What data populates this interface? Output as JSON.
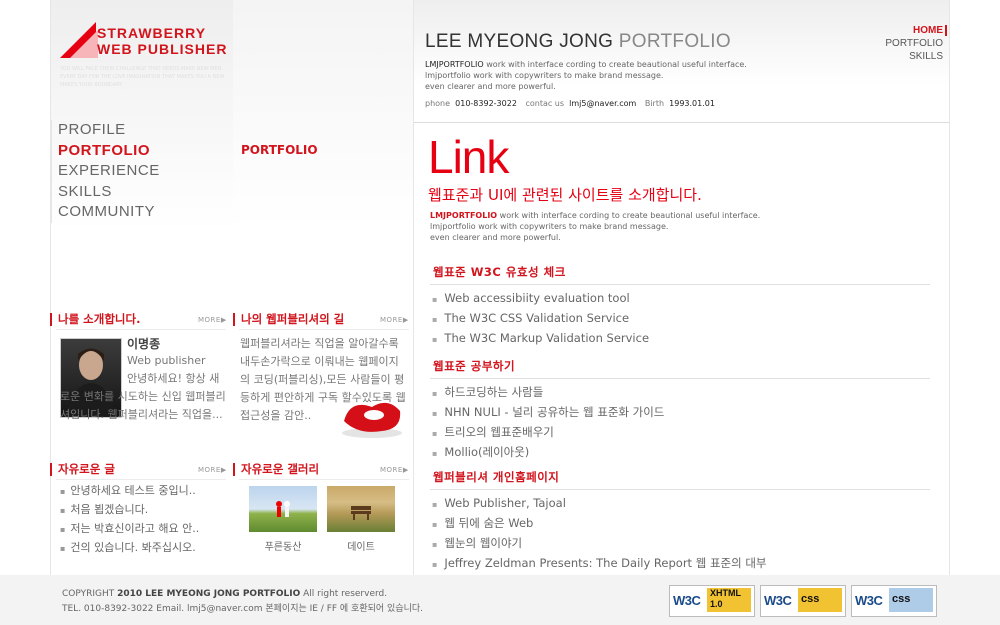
{
  "logo": {
    "line1": "STRAWBERRY",
    "line2": "WEB PUBLISHER",
    "tagline": "YOU WILL FACE THEIR CHALLENGE THAT NEEDS MAKE NEW MEN EVERY DAY FOR THE LOVE IMAGINATION THAT MAKES YOU A NEW MAKES YOUR BOUNDARY"
  },
  "nav": {
    "items": [
      "PROFILE",
      "PORTFOLIO",
      "EXPERIENCE",
      "SKILLS",
      "COMMUNITY"
    ]
  },
  "mid_title": "PORTFOLIO",
  "header": {
    "title_main": "LEE MYEONG JONG ",
    "title_accent": "PORTFOLIO",
    "desc_brand": "LMJPORTFOLIO",
    "desc1": " work with interface cording to create beautional useful interface.",
    "desc2": "lmjportfolio work with copywriters to make brand message.",
    "desc3": "even clearer and more powerful.",
    "phone_label": "phone",
    "phone": "010-8392-3022",
    "contact_label": "contac us",
    "email": "lmj5@naver.com",
    "birth_label": "Birth",
    "birth": "1993.01.01"
  },
  "top_menu": {
    "home": "HOME",
    "portfolio": "PORTFOLIO",
    "skills": "SKILLS"
  },
  "intro": {
    "heading": "나를 소개합니다.",
    "more": "MORE▶",
    "name": "이명종",
    "role": "Web publisher",
    "text": "안녕하세요! 항상 새로운 변화를 시도하는 신입 웹퍼블리셔입니다. 웹퍼블리셔라는 직업을..."
  },
  "road": {
    "heading": "나의 웹퍼블리셔의 길",
    "more": "MORE▶",
    "text": "웹퍼블리셔라는 직업을 알아갈수록 내두손가락으로 이뤄내는 웹페이지의 코딩(퍼블리싱),모든 사람들이 평등하게 편안하게 구독 할수있도록 웹접근성을 감안.."
  },
  "board": {
    "heading": "자유로운 글",
    "more": "MORE▶",
    "items": [
      "안녕하세요 테스트 중입니..",
      "처음 뵙겠습니다.",
      "저는 박효신이라고 해요 안..",
      "건의 있습니다. 봐주십시오."
    ]
  },
  "gallery": {
    "heading": "자유로운 갤러리",
    "more": "MORE▶",
    "captions": [
      "푸른동산",
      "데이트"
    ]
  },
  "main": {
    "title": "Link",
    "subtitle": "웹표준과 UI에 관련된 사이트를 소개합니다.",
    "desc_brand": "LMJPORTFOLIO",
    "desc1": " work with interface cording to create beautional useful interface.",
    "desc2": "lmjportfolio work with copywriters to make brand message.",
    "desc3": "even clearer and more powerful.",
    "categories": [
      {
        "title": "웹표준 W3C 유효성 체크",
        "links": [
          "Web accessibiity evaluation tool",
          "The W3C CSS Validation Service",
          "The W3C Markup Validation Service"
        ]
      },
      {
        "title": "웹표준 공부하기",
        "links": [
          "하드코딩하는 사람들",
          "NHN NULI - 널리 공유하는 웹 표준화 가이드",
          "트리오의 웹표준배우기",
          "Mollio(레이아웃)"
        ]
      },
      {
        "title": "웹퍼블리셔 개인홈페이지",
        "links": [
          "Web Publisher, Tajoal",
          "웹 뒤에 숨은 Web",
          "웹눈의 웹이야기",
          "Jeffrey Zeldman Presents: The Daily Report 웹 표준의 대부"
        ]
      }
    ]
  },
  "footer": {
    "copyright_pre": "COPYRIGHT ",
    "copyright_bold": "2010 LEE MYEONG JONG PORTFOLIO",
    "copyright_post": " All right reserverd.",
    "line2": "TEL. 010-8392-3022 Email. lmj5@naver.com 본페이지는 IE / FF 에 호환되어 있습니다."
  },
  "badges": [
    {
      "w3c": "W3C",
      "tag": "XHTML 1.0",
      "color": "#f1c232"
    },
    {
      "w3c": "W3C",
      "tag": "css",
      "color": "#f1c232"
    },
    {
      "w3c": "W3C",
      "tag": "css",
      "color": "#aecbe8"
    }
  ]
}
